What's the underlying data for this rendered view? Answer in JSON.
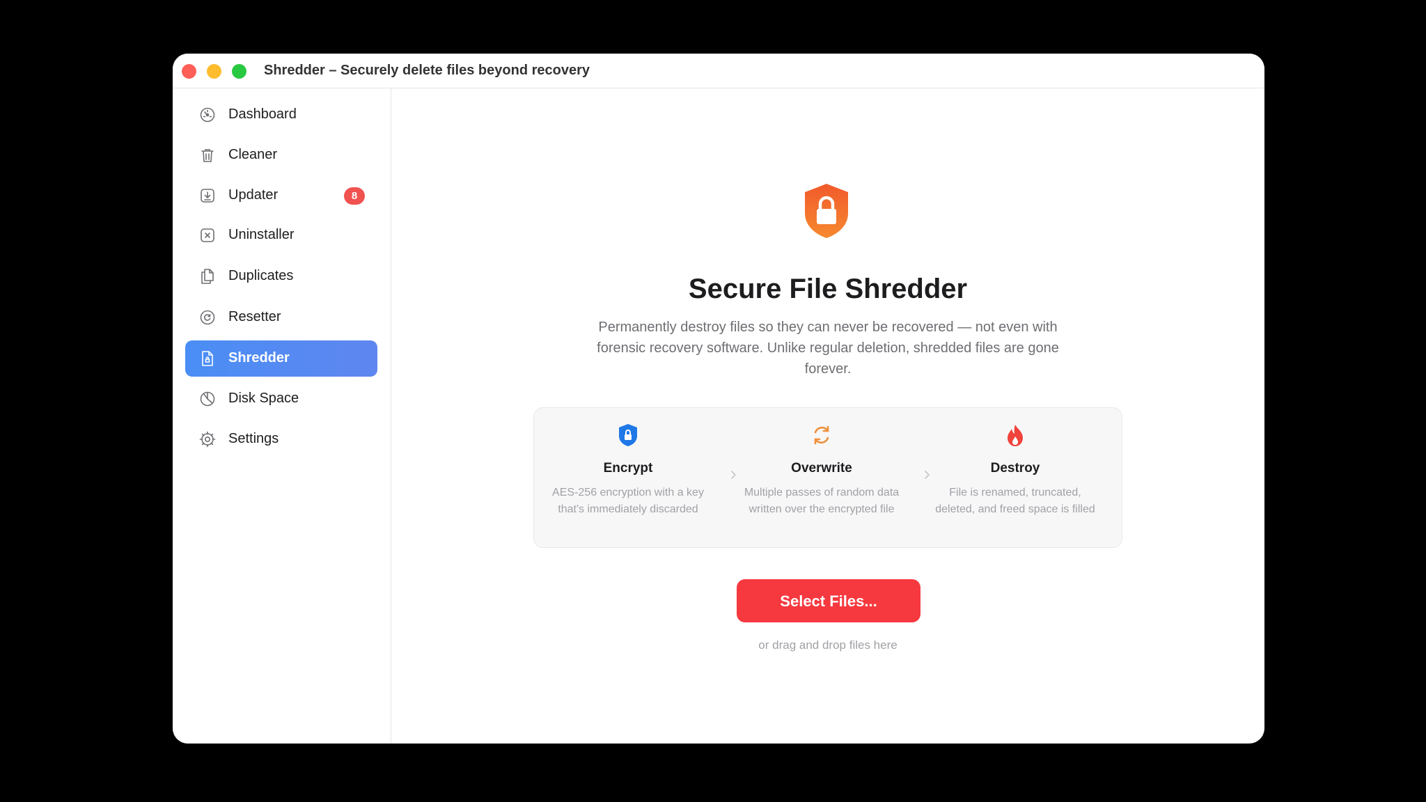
{
  "window": {
    "title": "Shredder – Securely delete files beyond recovery"
  },
  "sidebar": {
    "items": [
      {
        "label": "Dashboard",
        "icon": "dashboard-gauge-icon"
      },
      {
        "label": "Cleaner",
        "icon": "trash-icon"
      },
      {
        "label": "Updater",
        "icon": "download-box-icon",
        "badge": "8"
      },
      {
        "label": "Uninstaller",
        "icon": "x-box-icon"
      },
      {
        "label": "Duplicates",
        "icon": "duplicate-docs-icon"
      },
      {
        "label": "Resetter",
        "icon": "reset-icon"
      },
      {
        "label": "Shredder",
        "icon": "shred-doc-icon",
        "active": true
      },
      {
        "label": "Disk Space",
        "icon": "pie-chart-icon"
      },
      {
        "label": "Settings",
        "icon": "gear-icon"
      }
    ]
  },
  "main": {
    "hero_icon": "shield-lock-icon",
    "title": "Secure File Shredder",
    "description": "Permanently destroy files so they can never be recovered — not even with forensic recovery software. Unlike regular deletion, shredded files are gone forever.",
    "steps": [
      {
        "title": "Encrypt",
        "desc": "AES-256 encryption with a key that's immediately discarded",
        "icon": "shield-lock-icon"
      },
      {
        "title": "Overwrite",
        "desc": "Multiple passes of random data written over the encrypted file",
        "icon": "refresh-arrows-icon"
      },
      {
        "title": "Destroy",
        "desc": "File is renamed, truncated, deleted, and freed space is filled",
        "icon": "flame-icon"
      }
    ],
    "select_button": "Select Files...",
    "drop_hint": "or drag and drop files here"
  },
  "colors": {
    "accent": "#4a8ef5",
    "danger": "#f5393f",
    "badge": "#f0524f",
    "hero_orange": "#f26b2a",
    "encrypt_blue": "#1f78e6",
    "overwrite_orange": "#f0903a",
    "destroy_red": "#f0433c"
  }
}
